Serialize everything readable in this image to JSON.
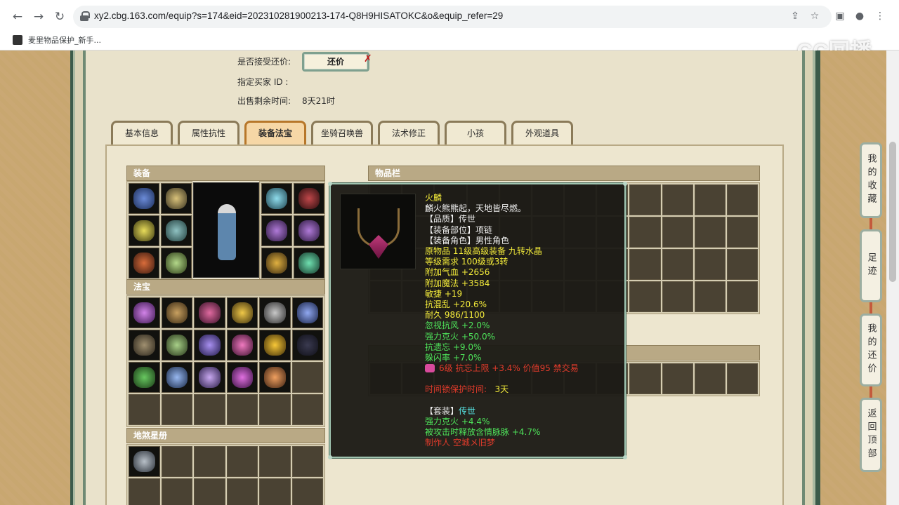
{
  "browser": {
    "url": "xy2.cbg.163.com/equip?s=174&eid=202310281900213-174-Q8H9HISATOKC&o&equip_refer=29",
    "bookmark_label": "麦里物品保护_新手..."
  },
  "watermark": "CC回播",
  "trade_info": {
    "accept_counter_label": "是否接受还价:",
    "counter_button": "还价",
    "counter_x": "✗",
    "buyer_id_label": "指定买家 ID :",
    "buyer_id_value": "",
    "remaining_label": "出售剩余时间:",
    "remaining_value": "8天21时"
  },
  "tabs": [
    {
      "label": "基本信息",
      "active": false
    },
    {
      "label": "属性抗性",
      "active": false
    },
    {
      "label": "装备法宝",
      "active": true
    },
    {
      "label": "坐骑召唤兽",
      "active": false
    },
    {
      "label": "法术修正",
      "active": false
    },
    {
      "label": "小孩",
      "active": false
    },
    {
      "label": "外观道具",
      "active": false
    }
  ],
  "sections": {
    "equipment": "装备",
    "treasure": "法宝",
    "star_book": "地煞星册",
    "items": "物品栏"
  },
  "tooltip": {
    "name": "火麟",
    "description": "麟火熊熊起，天地皆尽燃。",
    "quality": "【品质】传世",
    "slot": "【装备部位】项链",
    "role": "【装备角色】男性角色",
    "origin": "原物品 11级高级装备 九转水晶",
    "level_req": "等级需求 100级或3转",
    "hp_bonus": "附加气血 +2656",
    "mp_bonus": "附加魔法 +3584",
    "agility": "敏捷 +19",
    "anti_chaos": "抗混乱 +20.6%",
    "durability": "耐久 986/1100",
    "ignore_wind": "忽视抗风 +2.0%",
    "strong_fire": "强力克火 +50.0%",
    "anti_forget": "抗遗忘 +9.0%",
    "dodge": "躲闪率 +7.0%",
    "rune_line": "6级 抗忘上限 +3.4% 价值95 禁交易",
    "time_protect_label": "时间锁保护时间:",
    "time_protect_value": "3天",
    "set_label": "【套装】",
    "set_value": "传世",
    "set_fire": "强力克火 +4.4%",
    "set_skill": "被攻击时释放含情脉脉 +4.7%",
    "maker": "制作人 空城メ旧梦"
  },
  "side_buttons": [
    "我的收藏",
    "足迹",
    "我的还价",
    "返回顶部"
  ]
}
